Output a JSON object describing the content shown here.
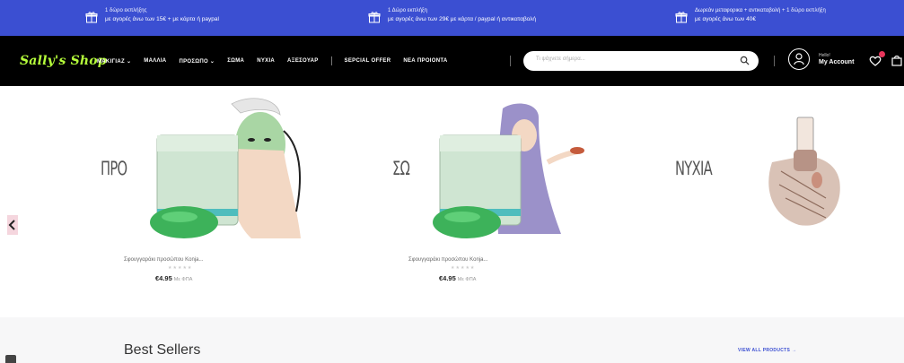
{
  "promo": [
    {
      "line1": "1 δώρο εκπλήξης",
      "line2": "με αγορές άνω των 15€ + με κάρτα ή paypal"
    },
    {
      "line1": "1 Δώρο εκπλήξη",
      "line2": "με αγορές άνω των 29€ με κάρτα / paypal ή αντικαταβολή"
    },
    {
      "line1": "Δωρεάν μεταφορικα + αντικαταβολή + 1 δώρο εκπλήξη",
      "line2": "με αγορές άνω των 40€"
    }
  ],
  "nav": {
    "logo": "Sally's Shop",
    "menu": [
      "ΜΑΚΙΓΙΑΖ ⌄",
      "ΜΑΛΛΙΑ",
      "ΠΡΟΣΩΠΟ ⌄",
      "ΣΩΜΑ",
      "ΝΥΧΙΑ",
      "ΑΞΕΣΟΥΑΡ"
    ],
    "menu2": [
      "SEPCIAL OFFER",
      "ΝΕΑ ΠΡΟΙΟΝΤΑ"
    ],
    "search_placeholder": "Τι ψάχνετε σήμερα...",
    "account_hello": "Hello!",
    "account_label": "My Account"
  },
  "hero": {
    "categories": [
      "ΠΡΟ",
      "ΣΩ",
      "ΝΥΧΙΑ"
    ],
    "products": [
      {
        "name": "Σφουγγαράκι προσώπου Konja...",
        "stars": "★★★★★",
        "price": "€4.95",
        "vat": "Με ΦΠΑ"
      },
      {
        "name": "Σφουγγαράκι προσώπου Konja...",
        "stars": "★★★★★",
        "price": "€4.95",
        "vat": "Με ΦΠΑ"
      }
    ]
  },
  "bestsellers": {
    "title": "Best Sellers",
    "view_all": "VIEW ALL PRODUCTS →"
  },
  "colors": {
    "promo_bg": "#3b4fd2",
    "nav_bg": "#000000",
    "logo": "#b6ff3b",
    "badge": "#e8355b"
  }
}
